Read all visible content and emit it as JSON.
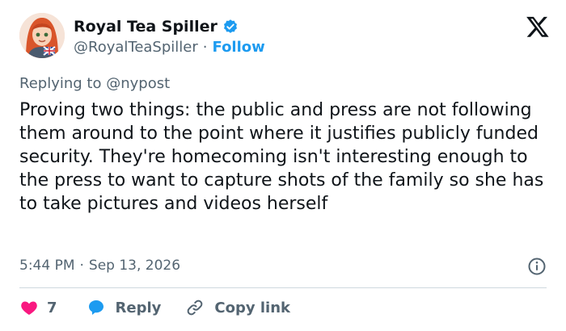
{
  "author": {
    "display_name": "Royal Tea Spiller",
    "handle": "@RoyalTeaSpiller",
    "separator": "·",
    "follow_label": "Follow"
  },
  "reply_context": {
    "prefix": "Replying to",
    "mention": "@nypost"
  },
  "tweet": {
    "text": "Proving two things: the public and press are not following them around to the point where it justifies publicly funded security. They're homecoming isn't interesting enough to the press to want to capture shots of the family so she has to take pictures and videos herself"
  },
  "meta": {
    "time": "5:44 PM",
    "separator": "·",
    "date": "Sep 13, 2026"
  },
  "actions": {
    "like_count": "7",
    "reply_label": "Reply",
    "copy_label": "Copy link"
  },
  "colors": {
    "accent": "#1d9bf0",
    "like": "#f91880",
    "muted": "#536471",
    "text": "#0f1419",
    "divider": "#cfd9de"
  },
  "icons": [
    "verified-badge-icon",
    "x-logo-icon",
    "info-icon",
    "heart-icon",
    "reply-bubble-icon",
    "link-icon"
  ]
}
